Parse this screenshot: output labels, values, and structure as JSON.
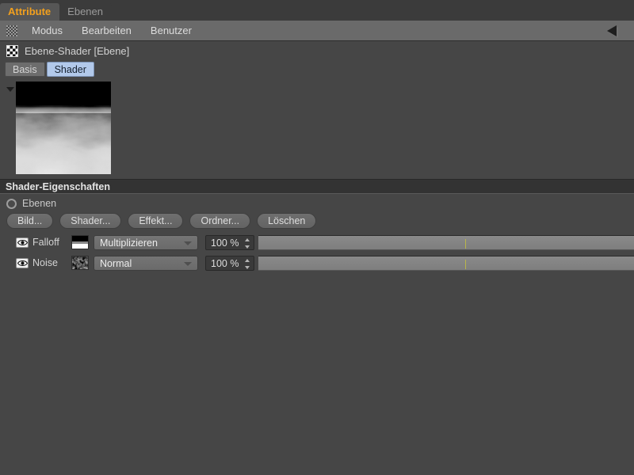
{
  "window": {
    "tabs": [
      {
        "label": "Attribute",
        "active": true
      },
      {
        "label": "Ebenen",
        "active": false
      }
    ]
  },
  "menubar": {
    "grip_icon": "checker-grip-icon",
    "items": [
      {
        "label": "Modus"
      },
      {
        "label": "Bearbeiten"
      },
      {
        "label": "Benutzer"
      }
    ],
    "collapse_icon": "left-triangle-icon"
  },
  "object": {
    "icon": "checkerboard-icon",
    "title": "Ebene-Shader [Ebene]"
  },
  "subtabs": [
    {
      "label": "Basis",
      "selected": false
    },
    {
      "label": "Shader",
      "selected": true
    }
  ],
  "preview": {
    "toggle_icon": "triangle-down-icon",
    "description": "noise-shader-preview"
  },
  "section": {
    "title": "Shader-Eigenschaften",
    "mode": {
      "label": "Ebenen",
      "icon": "radio-circle-icon"
    },
    "buttons": [
      {
        "label": "Bild..."
      },
      {
        "label": "Shader..."
      },
      {
        "label": "Effekt..."
      },
      {
        "label": "Ordner..."
      },
      {
        "label": "Löschen"
      }
    ]
  },
  "layers": [
    {
      "visibility_icon": "eye-icon",
      "name": "Falloff",
      "thumbnail": "gradient-black-white",
      "blend_mode": "Multiplizieren",
      "opacity": "100 %",
      "slider_value": 100,
      "slider_tick_percent": 55
    },
    {
      "visibility_icon": "eye-icon",
      "name": "Noise",
      "thumbnail": "noise-texture",
      "blend_mode": "Normal",
      "opacity": "100 %",
      "slider_value": 100,
      "slider_tick_percent": 55
    }
  ],
  "colors": {
    "panel_bg": "#464646",
    "tabstrip_bg": "#3b3b3b",
    "menubar_bg": "#6a6a6a",
    "accent_active_tab": "#f2a01e",
    "selected_subtab": "#b2c9ea",
    "section_header_bg": "#333333",
    "slider_fill": "#848484",
    "slider_tick": "#b9b54a"
  }
}
